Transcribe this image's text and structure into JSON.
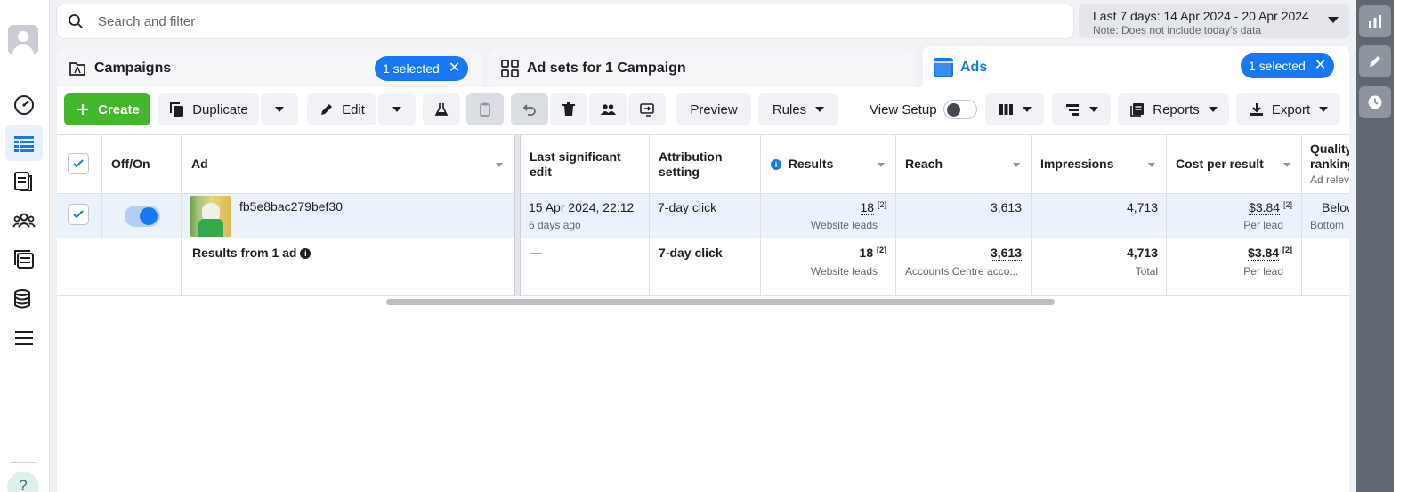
{
  "search": {
    "placeholder": "Search and filter"
  },
  "date_range": {
    "label": "Last 7 days: 14 Apr 2024 - 20 Apr 2024",
    "note": "Note: Does not include today's data"
  },
  "tabs": {
    "campaigns": {
      "title": "Campaigns",
      "selected": "1 selected"
    },
    "adsets": {
      "title": "Ad sets for 1 Campaign"
    },
    "ads": {
      "title": "Ads",
      "selected": "1 selected"
    }
  },
  "toolbar": {
    "create": "Create",
    "duplicate": "Duplicate",
    "edit": "Edit",
    "preview": "Preview",
    "rules": "Rules",
    "view_setup": "View Setup",
    "reports": "Reports",
    "export": "Export"
  },
  "table": {
    "headers": {
      "off_on": "Off/On",
      "ad": "Ad",
      "last_edit": "Last significant edit",
      "attribution": "Attribution setting",
      "results": "Results",
      "reach": "Reach",
      "impressions": "Impressions",
      "cost_per_result": "Cost per result",
      "quality": "Quality ranking",
      "quality_sub": "Ad relev"
    },
    "row": {
      "ad_name": "fb5e8bac279bef30",
      "last_edit": "15 Apr 2024, 22:12",
      "last_edit_sub": "6 days ago",
      "attribution": "7-day click",
      "results": "18",
      "results_foot": "[2]",
      "results_sub": "Website leads",
      "reach": "3,613",
      "impressions": "4,713",
      "cost": "$3.84",
      "cost_foot": "[2]",
      "cost_sub": "Per lead",
      "quality": "Below",
      "quality_sub": "Bottom"
    },
    "summary": {
      "label": "Results from 1 ad",
      "last_edit": "—",
      "attribution": "7-day click",
      "results": "18",
      "results_foot": "[2]",
      "results_sub": "Website leads",
      "reach": "3,613",
      "reach_sub": "Accounts Centre acco...",
      "impressions": "4,713",
      "impressions_sub": "Total",
      "cost": "$3.84",
      "cost_foot": "[2]",
      "cost_sub": "Per lead"
    }
  },
  "help": "?",
  "colors": {
    "accent": "#1877f2",
    "create": "#42b72a",
    "selected_row": "#ebf2fc"
  }
}
